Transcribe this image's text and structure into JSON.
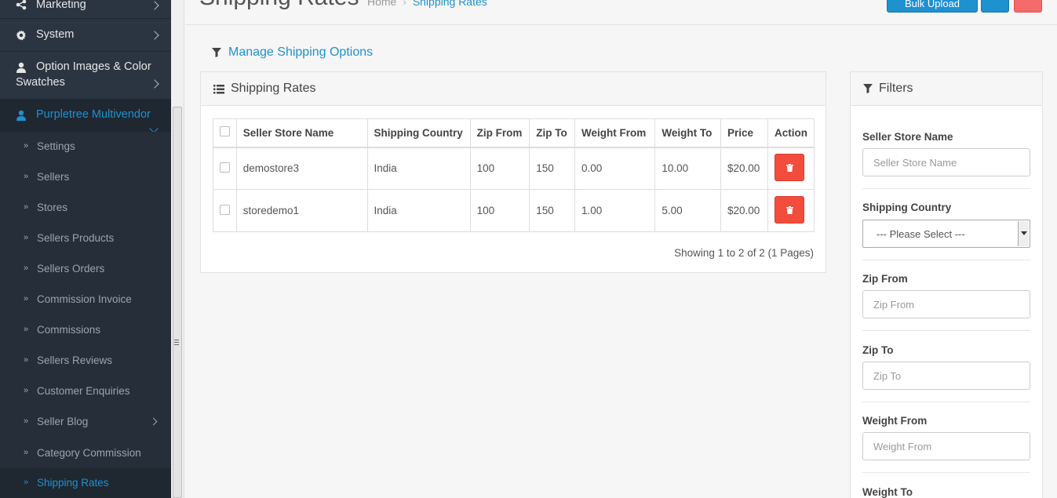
{
  "sidebar": {
    "marketing": "Marketing",
    "system": "System",
    "option_images_line1": "Option Images & Color",
    "option_images_line2": "Swatches",
    "purpletree": "Purpletree Multivendor",
    "sub_items": [
      "Settings",
      "Sellers",
      "Stores",
      "Sellers Products",
      "Sellers Orders",
      "Commission Invoice",
      "Commissions",
      "Sellers Reviews",
      "Customer Enquiries",
      "Seller Blog",
      "Category Commission",
      "Shipping Rates"
    ],
    "sub_arrow": "»"
  },
  "header": {
    "title": "Shipping Rates",
    "breadcrumb_home": "Home",
    "breadcrumb_sep": "›",
    "breadcrumb_current": "Shipping Rates",
    "bulk_upload": "Bulk Upload"
  },
  "manage_link": "Manage Shipping Options",
  "rates_panel": {
    "title": "Shipping Rates",
    "columns": [
      "Seller Store Name",
      "Shipping Country",
      "Zip From",
      "Zip To",
      "Weight From",
      "Weight To",
      "Price",
      "Action"
    ],
    "rows": [
      {
        "store": "demostore3",
        "country": "India",
        "zip_from": "100",
        "zip_to": "150",
        "weight_from": "0.00",
        "weight_to": "10.00",
        "price": "$20.00"
      },
      {
        "store": "storedemo1",
        "country": "India",
        "zip_from": "100",
        "zip_to": "150",
        "weight_from": "1.00",
        "weight_to": "5.00",
        "price": "$20.00"
      }
    ],
    "showing": "Showing 1 to 2 of 2 (1 Pages)"
  },
  "filters": {
    "title": "Filters",
    "seller_store_name_label": "Seller Store Name",
    "seller_store_name_placeholder": "Seller Store Name",
    "shipping_country_label": "Shipping Country",
    "shipping_country_value": "--- Please Select ---",
    "zip_from_label": "Zip From",
    "zip_from_placeholder": "Zip From",
    "zip_to_label": "Zip To",
    "zip_to_placeholder": "Zip To",
    "weight_from_label": "Weight From",
    "weight_from_placeholder": "Weight From",
    "weight_to_label": "Weight To"
  },
  "colors": {
    "accent": "#1e91cf",
    "sidebar_bg": "#2b3542",
    "danger": "#f24c3d"
  }
}
